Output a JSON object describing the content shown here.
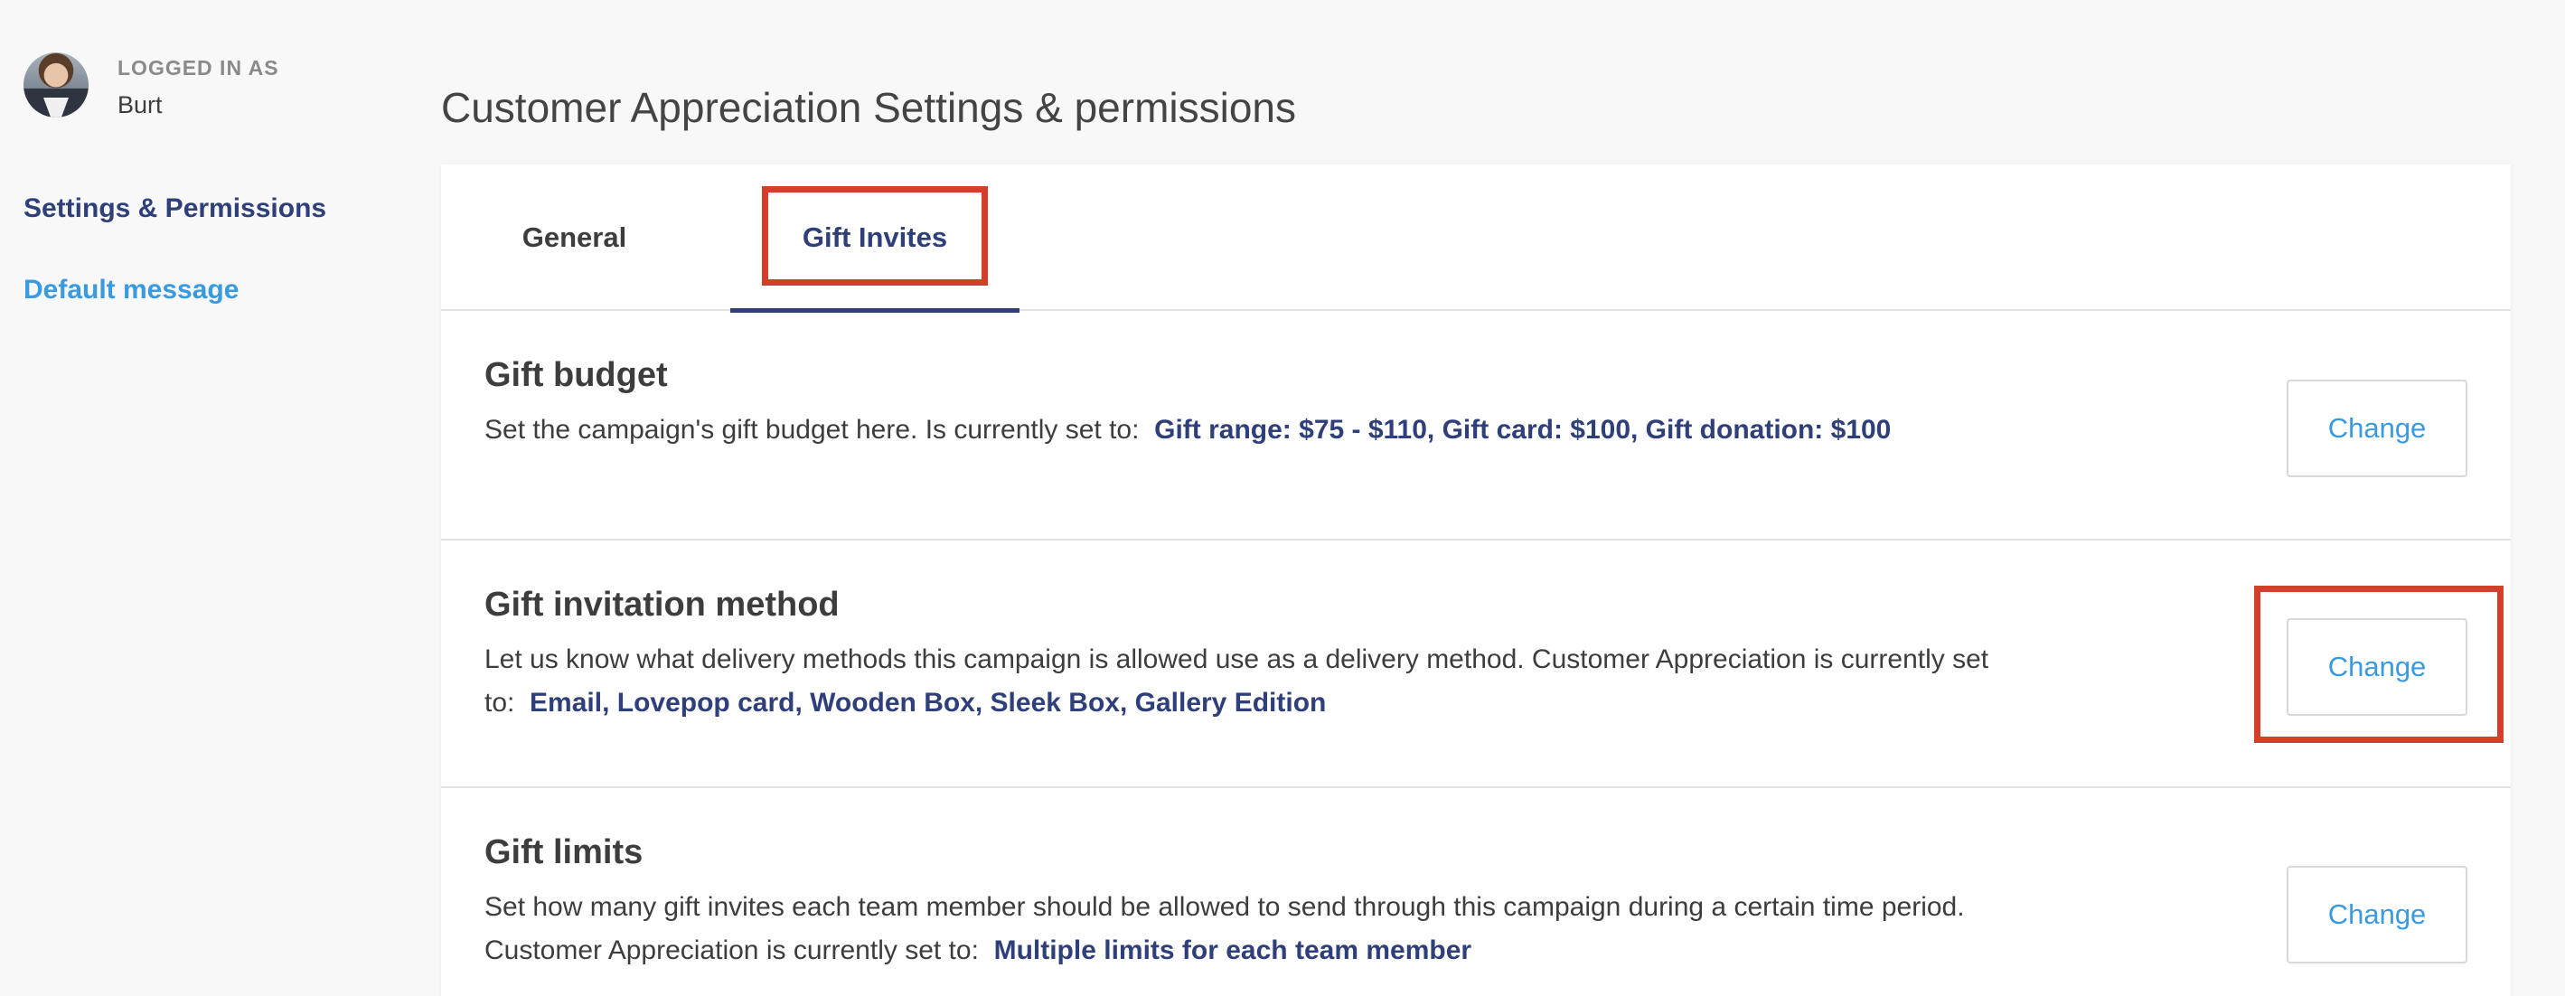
{
  "user": {
    "logged_in_label": "LOGGED IN AS",
    "name": "Burt"
  },
  "sidebar": {
    "items": [
      {
        "label": "Settings & Permissions",
        "active": true
      },
      {
        "label": "Default message",
        "active": false
      }
    ]
  },
  "page_title": "Customer Appreciation Settings & permissions",
  "tabs": [
    {
      "label": "General",
      "active": false
    },
    {
      "label": "Gift Invites",
      "active": true
    }
  ],
  "sections": [
    {
      "title": "Gift budget",
      "description": "Set the campaign's gift budget here. Is currently set to:",
      "value": "Gift range: $75 - $110, Gift card: $100, Gift donation: $100",
      "button": "Change"
    },
    {
      "title": "Gift invitation method",
      "description": "Let us know what delivery methods this campaign is allowed use as a delivery method. Customer Appreciation is currently set to:",
      "value": "Email, Lovepop card, Wooden Box, Sleek Box, Gallery Edition",
      "button": "Change"
    },
    {
      "title": "Gift limits",
      "description": "Set how many gift invites each team member should be allowed to send through this campaign during a certain time period. Customer Appreciation is currently set to:",
      "value": "Multiple limits for each team member",
      "button": "Change"
    }
  ],
  "colors": {
    "accent_dark": "#2e3f7a",
    "accent_link": "#3a9ae0",
    "highlight": "#d43f2b"
  }
}
